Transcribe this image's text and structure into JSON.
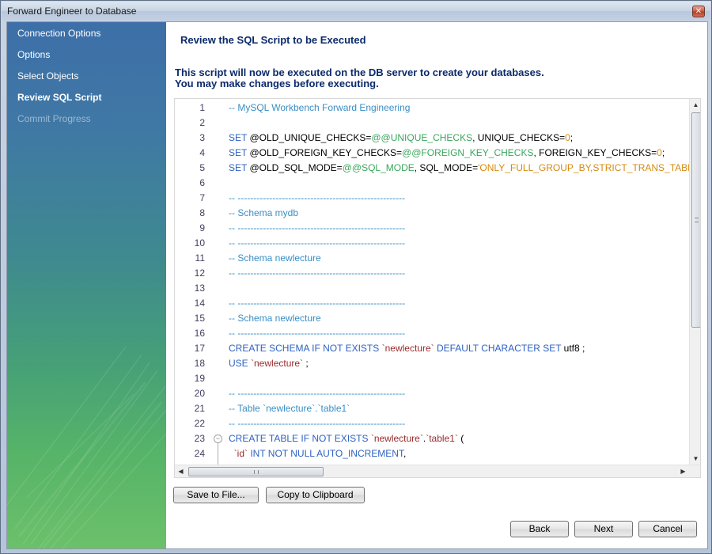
{
  "window": {
    "title": "Forward Engineer to Database",
    "close_glyph": "✕"
  },
  "sidebar": {
    "items": [
      {
        "label": "Connection Options",
        "state": "normal"
      },
      {
        "label": "Options",
        "state": "normal"
      },
      {
        "label": "Select Objects",
        "state": "normal"
      },
      {
        "label": "Review SQL Script",
        "state": "active"
      },
      {
        "label": "Commit Progress",
        "state": "disabled"
      }
    ]
  },
  "main": {
    "title": "Review the SQL Script to be Executed",
    "description_line1": "This script will now be executed on the DB server to create your databases.",
    "description_line2": "You may make changes before executing."
  },
  "editor": {
    "lines": [
      {
        "n": "1",
        "tokens": [
          [
            "cmt",
            "-- MySQL Workbench Forward Engineering"
          ]
        ]
      },
      {
        "n": "2",
        "tokens": []
      },
      {
        "n": "3",
        "tokens": [
          [
            "kw",
            "SET "
          ],
          [
            "plain",
            "@OLD_UNIQUE_CHECKS="
          ],
          [
            "var",
            "@@UNIQUE_CHECKS"
          ],
          [
            "plain",
            ", UNIQUE_CHECKS="
          ],
          [
            "num",
            "0"
          ],
          [
            "plain",
            ";"
          ]
        ]
      },
      {
        "n": "4",
        "tokens": [
          [
            "kw",
            "SET "
          ],
          [
            "plain",
            "@OLD_FOREIGN_KEY_CHECKS="
          ],
          [
            "var",
            "@@FOREIGN_KEY_CHECKS"
          ],
          [
            "plain",
            ", FOREIGN_KEY_CHECKS="
          ],
          [
            "num",
            "0"
          ],
          [
            "plain",
            ";"
          ]
        ]
      },
      {
        "n": "5",
        "tokens": [
          [
            "kw",
            "SET "
          ],
          [
            "plain",
            "@OLD_SQL_MODE="
          ],
          [
            "var",
            "@@SQL_MODE"
          ],
          [
            "plain",
            ", SQL_MODE="
          ],
          [
            "str",
            "'ONLY_FULL_GROUP_BY,STRICT_TRANS_TABLES"
          ]
        ]
      },
      {
        "n": "6",
        "tokens": []
      },
      {
        "n": "7",
        "tokens": [
          [
            "cmt",
            "-- -----------------------------------------------------"
          ]
        ]
      },
      {
        "n": "8",
        "tokens": [
          [
            "cmt",
            "-- Schema mydb"
          ]
        ]
      },
      {
        "n": "9",
        "tokens": [
          [
            "cmt",
            "-- -----------------------------------------------------"
          ]
        ]
      },
      {
        "n": "10",
        "tokens": [
          [
            "cmt",
            "-- -----------------------------------------------------"
          ]
        ]
      },
      {
        "n": "11",
        "tokens": [
          [
            "cmt",
            "-- Schema newlecture"
          ]
        ]
      },
      {
        "n": "12",
        "tokens": [
          [
            "cmt",
            "-- -----------------------------------------------------"
          ]
        ]
      },
      {
        "n": "13",
        "tokens": []
      },
      {
        "n": "14",
        "tokens": [
          [
            "cmt",
            "-- -----------------------------------------------------"
          ]
        ]
      },
      {
        "n": "15",
        "tokens": [
          [
            "cmt",
            "-- Schema newlecture"
          ]
        ]
      },
      {
        "n": "16",
        "tokens": [
          [
            "cmt",
            "-- -----------------------------------------------------"
          ]
        ]
      },
      {
        "n": "17",
        "tokens": [
          [
            "kw",
            "CREATE SCHEMA IF NOT EXISTS "
          ],
          [
            "bq",
            "`newlecture`"
          ],
          [
            "kw",
            " DEFAULT CHARACTER SET "
          ],
          [
            "plain",
            "utf8 ;"
          ]
        ]
      },
      {
        "n": "18",
        "tokens": [
          [
            "kw",
            "USE "
          ],
          [
            "bq",
            "`newlecture`"
          ],
          [
            "plain",
            " ;"
          ]
        ]
      },
      {
        "n": "19",
        "tokens": []
      },
      {
        "n": "20",
        "tokens": [
          [
            "cmt",
            "-- -----------------------------------------------------"
          ]
        ]
      },
      {
        "n": "21",
        "tokens": [
          [
            "cmt",
            "-- Table `newlecture`.`table1`"
          ]
        ]
      },
      {
        "n": "22",
        "tokens": [
          [
            "cmt",
            "-- -----------------------------------------------------"
          ]
        ]
      },
      {
        "n": "23",
        "tokens": [
          [
            "kw",
            "CREATE TABLE IF NOT EXISTS "
          ],
          [
            "bq",
            "`newlecture`"
          ],
          [
            "plain",
            "."
          ],
          [
            "bq",
            "`table1`"
          ],
          [
            "plain",
            " ("
          ]
        ]
      },
      {
        "n": "24",
        "tokens": [
          [
            "plain",
            "  "
          ],
          [
            "bq",
            "`id`"
          ],
          [
            "kw",
            " INT NOT NULL AUTO_INCREMENT"
          ],
          [
            "plain",
            ","
          ]
        ]
      }
    ],
    "fold_glyph": "−",
    "scroll_up": "▲",
    "scroll_down": "▼",
    "scroll_left": "◀",
    "scroll_right": "▶"
  },
  "buttons": {
    "save_to_file": "Save to File...",
    "copy_to_clipboard": "Copy to Clipboard",
    "back": "Back",
    "next": "Next",
    "cancel": "Cancel"
  }
}
